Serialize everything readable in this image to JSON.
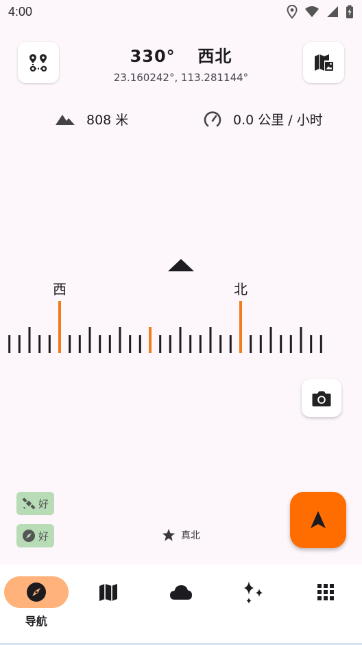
{
  "status_bar": {
    "time": "4:00",
    "icons": [
      "location-icon",
      "wifi-icon",
      "signal-icon",
      "battery-icon"
    ]
  },
  "header": {
    "heading_degrees": "330°",
    "heading_direction": "西北",
    "coordinates": "23.160242°, 113.281144°",
    "left_button_icon": "route-icon",
    "right_button_icon": "map-image-icon"
  },
  "metrics": {
    "altitude": "808 米",
    "speed": "0.0 公里 / 小时"
  },
  "compass": {
    "heading_deg": 330,
    "labels": [
      "西",
      "北"
    ],
    "accent_color": "#f07d1a",
    "tick_color": "#1c1b1f"
  },
  "status_badges": {
    "gps": "好",
    "compass": "好"
  },
  "north_reference": "真北",
  "colors": {
    "fab": "#ff6d00",
    "nav_active": "#ffb27a",
    "badge_bg": "#b7dcb6",
    "background": "#fdf6fb"
  },
  "bottom_nav": {
    "items": [
      {
        "label": "导航",
        "icon": "compass-icon",
        "active": true
      },
      {
        "label": "",
        "icon": "map-icon",
        "active": false
      },
      {
        "label": "",
        "icon": "cloud-icon",
        "active": false
      },
      {
        "label": "",
        "icon": "sparkle-icon",
        "active": false
      },
      {
        "label": "",
        "icon": "apps-grid-icon",
        "active": false
      }
    ]
  }
}
